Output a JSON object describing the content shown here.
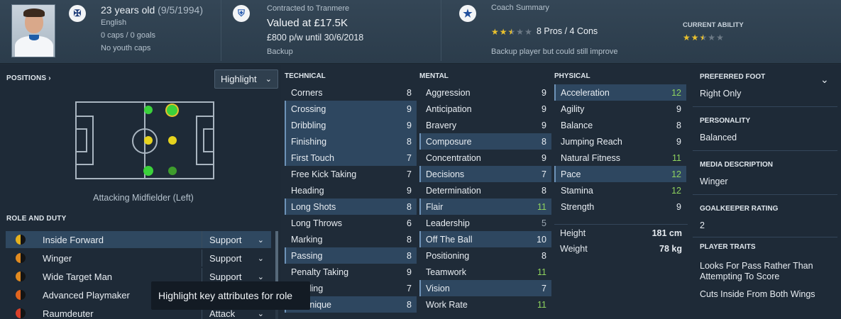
{
  "header": {
    "age": "23 years old",
    "dob": "(9/5/1994)",
    "nationality": "English",
    "caps": "0 caps / 0 goals",
    "youth_caps": "No youth caps",
    "contract_label": "Contracted to Tranmere",
    "value": "Valued at £17.5K",
    "wage": "£800 p/w until 30/6/2018",
    "squad_status": "Backup",
    "coach_label": "Coach Summary",
    "pros_cons": "8 Pros / 4 Cons",
    "coach_note": "Backup player but could still improve",
    "current_ability_label": "CURRENT ABILITY",
    "coach_stars": 2.5,
    "ability_stars": 2.5
  },
  "positions": {
    "title": "POSITIONS",
    "chevron": "›",
    "highlight_label": "Highlight",
    "selected_position": "Attacking Midfielder (Left)"
  },
  "roles": {
    "title": "ROLE AND DUTY",
    "items": [
      {
        "name": "Inside Forward",
        "duty": "Support",
        "color": "#e6b11e",
        "selected": true
      },
      {
        "name": "Winger",
        "duty": "Support",
        "color": "#e08a20",
        "selected": false
      },
      {
        "name": "Wide Target Man",
        "duty": "Support",
        "color": "#e08a20",
        "selected": false
      },
      {
        "name": "Advanced Playmaker",
        "duty": "Support",
        "color": "#e0641e",
        "selected": false
      },
      {
        "name": "Raumdeuter",
        "duty": "Attack",
        "color": "#d8402a",
        "selected": false
      }
    ],
    "tooltip": "Highlight key attributes for role"
  },
  "technical": {
    "title": "TECHNICAL",
    "rows": [
      {
        "label": "Corners",
        "value": "8",
        "hl": false
      },
      {
        "label": "Crossing",
        "value": "9",
        "hl": true
      },
      {
        "label": "Dribbling",
        "value": "9",
        "hl": true
      },
      {
        "label": "Finishing",
        "value": "8",
        "hl": true
      },
      {
        "label": "First Touch",
        "value": "7",
        "hl": true
      },
      {
        "label": "Free Kick Taking",
        "value": "7",
        "hl": false
      },
      {
        "label": "Heading",
        "value": "9",
        "hl": false
      },
      {
        "label": "Long Shots",
        "value": "8",
        "hl": true
      },
      {
        "label": "Long Throws",
        "value": "6",
        "hl": false
      },
      {
        "label": "Marking",
        "value": "8",
        "hl": false
      },
      {
        "label": "Passing",
        "value": "8",
        "hl": true
      },
      {
        "label": "Penalty Taking",
        "value": "9",
        "hl": false
      },
      {
        "label": "Tackling",
        "value": "7",
        "hl": false
      },
      {
        "label": "Technique",
        "value": "8",
        "hl": true
      }
    ]
  },
  "mental": {
    "title": "MENTAL",
    "rows": [
      {
        "label": "Aggression",
        "value": "9",
        "hl": false
      },
      {
        "label": "Anticipation",
        "value": "9",
        "hl": false
      },
      {
        "label": "Bravery",
        "value": "9",
        "hl": false
      },
      {
        "label": "Composure",
        "value": "8",
        "hl": true
      },
      {
        "label": "Concentration",
        "value": "9",
        "hl": false
      },
      {
        "label": "Decisions",
        "value": "7",
        "hl": true
      },
      {
        "label": "Determination",
        "value": "8",
        "hl": false
      },
      {
        "label": "Flair",
        "value": "11",
        "hl": true,
        "good": true
      },
      {
        "label": "Leadership",
        "value": "5",
        "hl": false,
        "low": true
      },
      {
        "label": "Off The Ball",
        "value": "10",
        "hl": true
      },
      {
        "label": "Positioning",
        "value": "8",
        "hl": false
      },
      {
        "label": "Teamwork",
        "value": "11",
        "hl": false,
        "good": true
      },
      {
        "label": "Vision",
        "value": "7",
        "hl": true
      },
      {
        "label": "Work Rate",
        "value": "11",
        "hl": false,
        "good": true
      }
    ]
  },
  "physical": {
    "title": "PHYSICAL",
    "rows": [
      {
        "label": "Acceleration",
        "value": "12",
        "hl": true,
        "good": true
      },
      {
        "label": "Agility",
        "value": "9",
        "hl": false
      },
      {
        "label": "Balance",
        "value": "8",
        "hl": false
      },
      {
        "label": "Jumping Reach",
        "value": "9",
        "hl": false
      },
      {
        "label": "Natural Fitness",
        "value": "11",
        "hl": false,
        "good": true
      },
      {
        "label": "Pace",
        "value": "12",
        "hl": true,
        "good": true
      },
      {
        "label": "Stamina",
        "value": "12",
        "hl": false,
        "good": true
      },
      {
        "label": "Strength",
        "value": "9",
        "hl": false
      }
    ],
    "height_label": "Height",
    "height_value": "181 cm",
    "weight_label": "Weight",
    "weight_value": "78 kg"
  },
  "info": {
    "preferred_foot_title": "PREFERRED FOOT",
    "preferred_foot": "Right Only",
    "personality_title": "PERSONALITY",
    "personality": "Balanced",
    "media_title": "MEDIA DESCRIPTION",
    "media": "Winger",
    "gk_title": "GOALKEEPER RATING",
    "gk": "2",
    "traits_title": "PLAYER TRAITS",
    "traits": [
      "Looks For Pass Rather Than Attempting To Score",
      "Cuts Inside From Both Wings"
    ]
  }
}
